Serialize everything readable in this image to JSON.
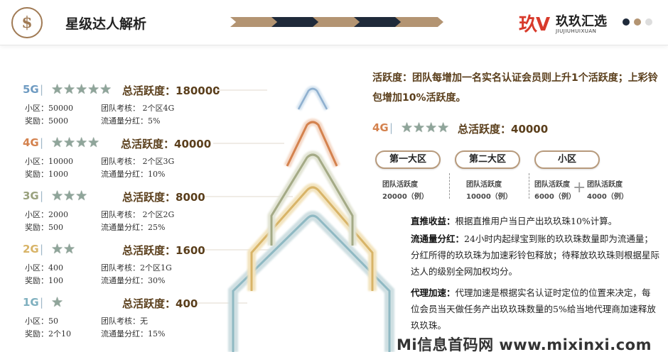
{
  "header": {
    "logo_glyph": "$",
    "title": "星级达人解析",
    "brand_mark": "玖V",
    "brand_name": "玖玖汇选",
    "brand_sub": "JIUJIUHUIXUAN",
    "chevron_colors": [
      "#b39472",
      "#1f2a3a",
      "#b39472",
      "#1f2a3a",
      "#b39472"
    ],
    "dot_colors": [
      "#1f2a3a",
      "#b39472",
      "#dddddd"
    ]
  },
  "tiers": [
    {
      "code": "5G",
      "sep": "|",
      "stars": "★★★★★",
      "total": "总活跃度：180000",
      "community": "小区：50000",
      "team": "团队考核：  2个区4G",
      "reward": "奖励：5000",
      "bonus": "流通量分红：5%",
      "color": "#6f9bc2"
    },
    {
      "code": "4G",
      "sep": "|",
      "stars": "★★★★",
      "total": "总活跃度：40000",
      "community": "小区：10000",
      "team": "团队考核：  2个区3G",
      "reward": "奖励：1000",
      "bonus": "流通量分红：10%",
      "color": "#d4824e"
    },
    {
      "code": "3G",
      "sep": "|",
      "stars": "★★★",
      "total": "总活跃度：8000",
      "community": "小区：2000",
      "team": "团队考核：  2个区2G",
      "reward": "奖励：500",
      "bonus": "流通量分红：25%",
      "color": "#9aa27e"
    },
    {
      "code": "2G",
      "sep": "|",
      "stars": "★★",
      "total": "总活跃度：1600",
      "community": "小区：400",
      "team": "团队考核：2个区1G",
      "reward": "奖励：100",
      "bonus": "流通量分红：30%",
      "color": "#d8b468"
    },
    {
      "code": "1G",
      "sep": "|",
      "stars": "★",
      "total": "总活跃度：400",
      "community": "小区：50",
      "team": "团队考核：无",
      "reward": "奖励：2个10",
      "bonus": "流通量分红：15%",
      "color": "#7fb0bf"
    }
  ],
  "rule": {
    "text": "活跃度：团队每增加一名实名认证会员则上升1个活跃度；上彩铃包增加10%活跃度。"
  },
  "example": {
    "code": "4G",
    "sep": "|",
    "stars": "★★★★",
    "total": "总活跃度：40000",
    "zones": [
      {
        "label": "第一大区",
        "line1": "团队活跃度",
        "line2": "20000（例）"
      },
      {
        "label": "第二大区",
        "line1": "团队活跃度",
        "line2": "10000（例）"
      },
      {
        "label": "小区",
        "line1": "团队活跃度",
        "line2": "6000（例）",
        "line3": "团队活跃度",
        "line4": "4000（例）"
      }
    ],
    "plus": "+"
  },
  "paragraphs": [
    {
      "title": "直推收益：",
      "body": "根据直推用户当日产出玖玖珠10%计算。"
    },
    {
      "title": "流通量分红：",
      "body": "24小时内起绿宝到账的玖玖珠数量即为流通量；分红所得的玖玖珠为加速彩铃包释放；待释放玖玖珠则根据星际达人的级别全网加权均分。"
    },
    {
      "title": "代理加速：",
      "body": "代理加速是根据实名认证时定位的位置来决定，每位会员当天做任务产出玖玖珠数量的5%给当地代理商加速释放玖玖珠。"
    }
  ],
  "watermark": "Mi信息首码网 www.mixinxi.com"
}
